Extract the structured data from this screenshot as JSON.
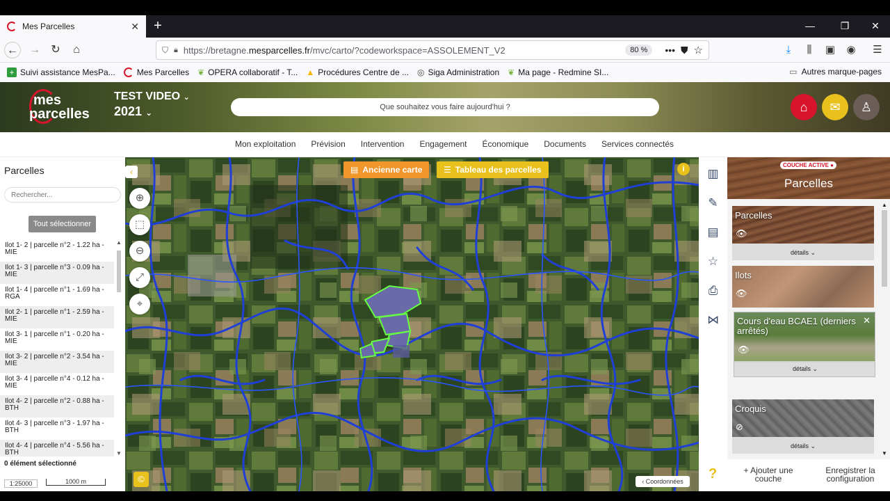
{
  "browser": {
    "tab_title": "Mes Parcelles",
    "new_tab": "+",
    "url_prefix": "https://bretagne.",
    "url_domain": "mesparcelles.fr",
    "url_path": "/mvc/carto/?codeworkspace=ASSOLEMENT_V2",
    "zoom": "80 %",
    "bookmarks": [
      {
        "label": "Suivi assistance MesPa...",
        "icon": "plus-icon",
        "color": "#2e9b3d"
      },
      {
        "label": "Mes Parcelles",
        "icon": "mesparcelles-icon",
        "color": "#d8142c"
      },
      {
        "label": "OPERA collaboratif - T...",
        "icon": "leaf-icon",
        "color": "#7cb342"
      },
      {
        "label": "Procédures Centre de ...",
        "icon": "drive-icon",
        "color": "#f4b400"
      },
      {
        "label": "Siga Administration",
        "icon": "globe-icon",
        "color": "#444444"
      },
      {
        "label": "Ma page - Redmine SI...",
        "icon": "leaf-icon",
        "color": "#7cb342"
      }
    ],
    "other_bookmarks": "Autres marque-pages"
  },
  "app": {
    "logo_line1": "mes",
    "logo_line2": "parcelles",
    "farm_name": "TEST VIDEO",
    "year": "2021",
    "search_placeholder": "Que souhaitez vous faire aujourd'hui ?",
    "menu": [
      "Mon exploitation",
      "Prévision",
      "Intervention",
      "Engagement",
      "Économique",
      "Documents",
      "Services connectés"
    ]
  },
  "left_panel": {
    "title": "Parcelles",
    "search_placeholder": "Rechercher...",
    "select_all": "Tout sélectionner",
    "items": [
      {
        "line1": "Ilot 1- 2 | parcelle n°2 - 1.22 ha -",
        "line2": "MIE"
      },
      {
        "line1": "Ilot 1- 3 | parcelle n°3 - 0.09 ha -",
        "line2": "MIE"
      },
      {
        "line1": "Ilot 1- 4 | parcelle n°1 - 1.69 ha -",
        "line2": "RGA"
      },
      {
        "line1": "Ilot 2- 1 | parcelle n°1 - 2.59 ha -",
        "line2": "MIE"
      },
      {
        "line1": "Ilot 3- 1 | parcelle n°1 - 0.20 ha -",
        "line2": "MIE"
      },
      {
        "line1": "Ilot 3- 2 | parcelle n°2 - 3.54 ha -",
        "line2": "MIE"
      },
      {
        "line1": "Ilot 3- 4 | parcelle n°4 - 0.12 ha -",
        "line2": "MIE"
      },
      {
        "line1": "Ilot 4- 2 | parcelle n°2 - 0.88 ha -",
        "line2": "BTH"
      },
      {
        "line1": "Ilot 4- 3 | parcelle n°3 - 1.97 ha -",
        "line2": "BTH"
      },
      {
        "line1": "Ilot 4- 4 | parcelle n°4 - 5.56 ha -",
        "line2": "BTH"
      }
    ],
    "selected_count": "0 élément sélectionné",
    "scale_ratio": "1:25000",
    "scale_bar": "1000 m"
  },
  "map": {
    "old_map_button": "Ancienne carte",
    "table_button": "Tableau des parcelles",
    "info": "i",
    "copyright": "©",
    "coordinates_button": "Coordonnées"
  },
  "layers_panel": {
    "active_badge": "COUCHE ACTIVE",
    "active_title": "Parcelles",
    "details_label": "détails",
    "layers": [
      {
        "name": "Parcelles"
      },
      {
        "name": "Ilots"
      },
      {
        "name": "Cours d'eau BCAE1 (derniers arrêtés)"
      },
      {
        "name": "Croquis"
      }
    ],
    "add_layer": "+ Ajouter une couche",
    "save_config": "Enregistrer la configuration",
    "help": "?"
  },
  "colors": {
    "brand_red": "#d8142c",
    "accent_yellow": "#e8c11c",
    "accent_orange": "#f0962a",
    "river_blue": "#1f3fd6",
    "parcel_green": "#66ff44"
  }
}
